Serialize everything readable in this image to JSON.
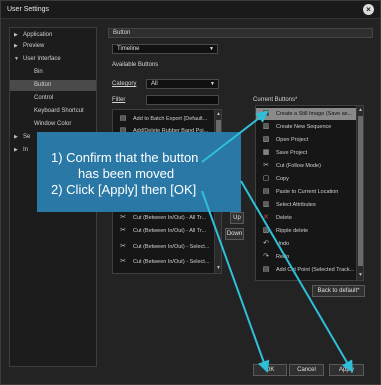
{
  "window": {
    "title": "User Settings"
  },
  "tree": {
    "items": [
      {
        "label": "Application",
        "arrow": "▶"
      },
      {
        "label": "Preview",
        "arrow": "▶"
      },
      {
        "label": "User Interface",
        "arrow": "▼"
      },
      {
        "label": "Bin",
        "arrow": ""
      },
      {
        "label": "Button",
        "arrow": ""
      },
      {
        "label": "Control",
        "arrow": ""
      },
      {
        "label": "Keyboard Shortcut",
        "arrow": ""
      },
      {
        "label": "Window Color",
        "arrow": ""
      },
      {
        "label": "Se",
        "arrow": "▶"
      },
      {
        "label": "In",
        "arrow": "▶"
      }
    ]
  },
  "panel": {
    "heading": "Button",
    "target_select": "Timeline",
    "available_label": "Available Buttons",
    "category_label": "Category",
    "category_value": "All",
    "filter_label": "Filter",
    "current_label": "Current Buttons*"
  },
  "available_buttons": [
    {
      "icon": "▤",
      "label": "Add to Batch Export (Default..."
    },
    {
      "icon": "▤",
      "label": "Add/Delete Rubber Band Poi..."
    },
    {
      "icon": "✂",
      "label": "Cut (Between In/Out) - All Tr..."
    },
    {
      "icon": "✂",
      "label": "Cut (Between In/Out) - All Tr..."
    },
    {
      "icon": "✂",
      "label": "Cut (Between In/Out) - Select..."
    },
    {
      "icon": "✂",
      "label": "Cut (Between In/Out) - Select..."
    }
  ],
  "current_buttons": [
    {
      "icon": "▣",
      "label": "Create a Still Image (Save as...",
      "selected": true
    },
    {
      "icon": "▥",
      "label": "Create New Sequence"
    },
    {
      "icon": "▧",
      "label": "Open Project"
    },
    {
      "icon": "▦",
      "label": "Save Project"
    },
    {
      "icon": "✂",
      "label": "Cut (Follow Mode)"
    },
    {
      "icon": "▢",
      "label": "Copy"
    },
    {
      "icon": "▤",
      "label": "Paste to Current Location"
    },
    {
      "icon": "▥",
      "label": "Select Attributes"
    },
    {
      "icon": "✕",
      "label": "Delete"
    },
    {
      "icon": "▧",
      "label": "Ripple delete"
    },
    {
      "icon": "↶",
      "label": "Undo"
    },
    {
      "icon": "↷",
      "label": "Redo"
    },
    {
      "icon": "▤",
      "label": "Add Cut Point (Selected Track..."
    }
  ],
  "middle_buttons": {
    "up": "Up",
    "down": "Down"
  },
  "back_default": "Back to default*",
  "footer": {
    "ok": "OK",
    "cancel": "Cancel",
    "apply": "Apply"
  },
  "callout": {
    "line1": "1)  Confirm that the button",
    "line2": "has been moved",
    "line3": "2)  Click [Apply] then [OK]"
  },
  "colors": {
    "callout": "#2a78a6",
    "arrow": "#2fc0d8"
  }
}
